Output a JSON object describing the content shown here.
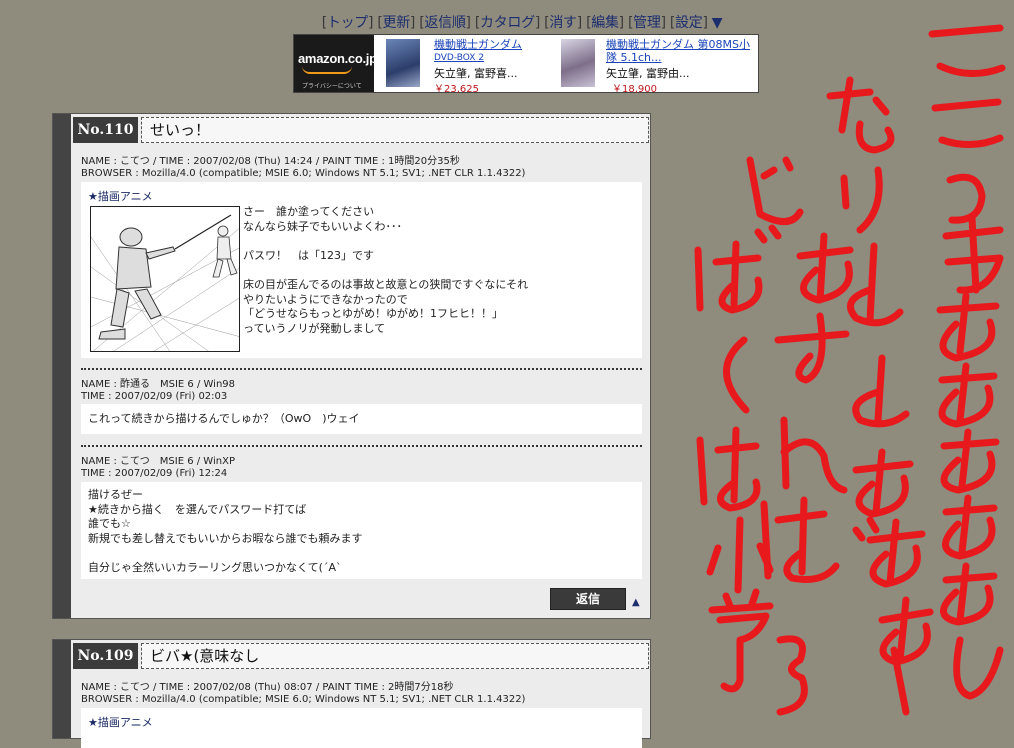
{
  "nav": {
    "items": [
      "トップ",
      "更新",
      "返信順",
      "カタログ",
      "消す",
      "編集",
      "管理",
      "設定"
    ],
    "arrow": "▼"
  },
  "ad": {
    "logo": "amazon.co.jp",
    "privacy": "プライバシーについて",
    "products": [
      {
        "title": "機動戦士ガンダム",
        "subtitle": "DVD-BOX 2",
        "author": "矢立肇, 富野喜...",
        "price": "￥23,625"
      },
      {
        "title_line1": "機動戦士ガンダム 第08MS小",
        "title_line2": "隊 5.1ch...",
        "author": "矢立肇, 富野由...",
        "price": "￥18,900"
      }
    ]
  },
  "posts": [
    {
      "number": "No.110",
      "title": "せいっ！",
      "meta_line1": "NAME : こてつ / TIME : 2007/02/08 (Thu) 14:24 / PAINT TIME : 1時間20分35秒",
      "meta_line2": "BROWSER : Mozilla/4.0 (compatible; MSIE 6.0; Windows NT 5.1; SV1; .NET CLR 1.1.4322)",
      "anime_link": "★描画アニメ",
      "body": "さー　誰か塗ってください\nなんなら妹子でもいいよくわ･･･\n\nパスワ！　は「123」です\n\n床の目が歪んでるのは事故と故意との狭間ですぐなにそれ\nやりたいようにできなかったので\n「どうせならもっとゆがめ！ゆがめ！1フヒヒ！！」\nっていうノリが発動しまして",
      "replies": [
        {
          "meta_line1": "NAME : 酢通る　MSIE 6 / Win98",
          "meta_line2": "TIME : 2007/02/09 (Fri) 02:03",
          "body": "これって続きから描けるんでしゅか？（OwO　)ウェイ"
        },
        {
          "meta_line1": "NAME : こてつ　MSIE 6 / WinXP",
          "meta_line2": "TIME : 2007/02/09 (Fri) 12:24",
          "body": "描けるぜー\n★続きから描く　を選んでパスワード打てば\n誰でも☆\n新規でも差し替えでもいいからお暇なら誰でも頼みます\n\n自分じゃ全然いいカラーリング思いつかなくて(´A`"
        }
      ],
      "reply_button": "返信",
      "up_arrow": "▲"
    },
    {
      "number": "No.109",
      "title": "ビバ★(意味なし",
      "meta_line1": "NAME : こてつ / TIME : 2007/02/08 (Thu) 08:07 / PAINT TIME : 2時間7分18秒",
      "meta_line2": "BROWSER : Mozilla/4.0 (compatible; MSIE 6.0; Windows NT 5.1; SV1; .NET CLR 1.1.4322)",
      "anime_link": "★描画アニメ"
    }
  ],
  "scribble": {
    "color": "#e8191c",
    "columns": [
      "ここってさあああああん",
      "なりよよおおおー",
      "どおすればばー",
      "ぼくは小学3"
    ]
  }
}
